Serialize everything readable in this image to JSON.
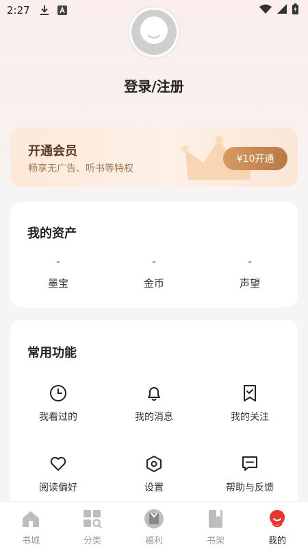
{
  "status_bar": {
    "time": "2:27"
  },
  "profile": {
    "login_label": "登录/注册"
  },
  "vip": {
    "title": "开通会员",
    "subtitle": "畅享无广告、听书等特权",
    "button_label": "¥10开通"
  },
  "assets": {
    "title": "我的资产",
    "items": [
      {
        "value": "-",
        "label": "墨宝"
      },
      {
        "value": "-",
        "label": "金币"
      },
      {
        "value": "-",
        "label": "声望"
      }
    ]
  },
  "functions": {
    "title": "常用功能",
    "items": [
      {
        "label": "我看过的",
        "icon": "clock-icon"
      },
      {
        "label": "我的消息",
        "icon": "bell-icon"
      },
      {
        "label": "我的关注",
        "icon": "bookmark-check-icon"
      },
      {
        "label": "阅读偏好",
        "icon": "heart-icon"
      },
      {
        "label": "设置",
        "icon": "settings-hexagon-icon"
      },
      {
        "label": "帮助与反馈",
        "icon": "message-square-icon"
      }
    ]
  },
  "nav": {
    "items": [
      {
        "label": "书城",
        "icon": "house-icon",
        "active": false
      },
      {
        "label": "分类",
        "icon": "grid-search-icon",
        "active": false
      },
      {
        "label": "福利",
        "icon": "gift-icon",
        "active": false
      },
      {
        "label": "书架",
        "icon": "bookshelf-icon",
        "active": false
      },
      {
        "label": "我的",
        "icon": "profile-icon",
        "active": true
      }
    ]
  },
  "colors": {
    "accent_red": "#e8342b",
    "vip_button": "#c58750",
    "nav_inactive": "#bdbdbd"
  }
}
